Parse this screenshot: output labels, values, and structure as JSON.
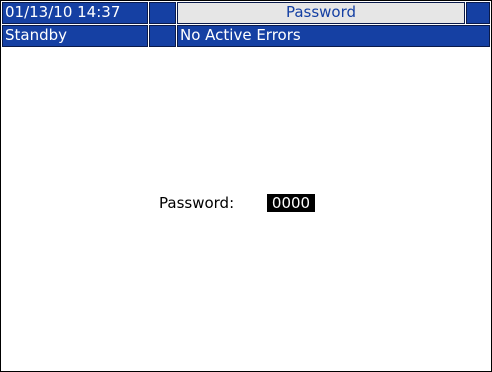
{
  "header": {
    "datetime": "01/13/10 14:37",
    "screen_title": "Password",
    "status": "Standby",
    "errors": "No Active Errors"
  },
  "password": {
    "label": "Password:",
    "value": "0000"
  },
  "colors": {
    "header_blue": "#1540a3",
    "title_bg": "#e6e6e6",
    "field_bg": "#000000"
  }
}
